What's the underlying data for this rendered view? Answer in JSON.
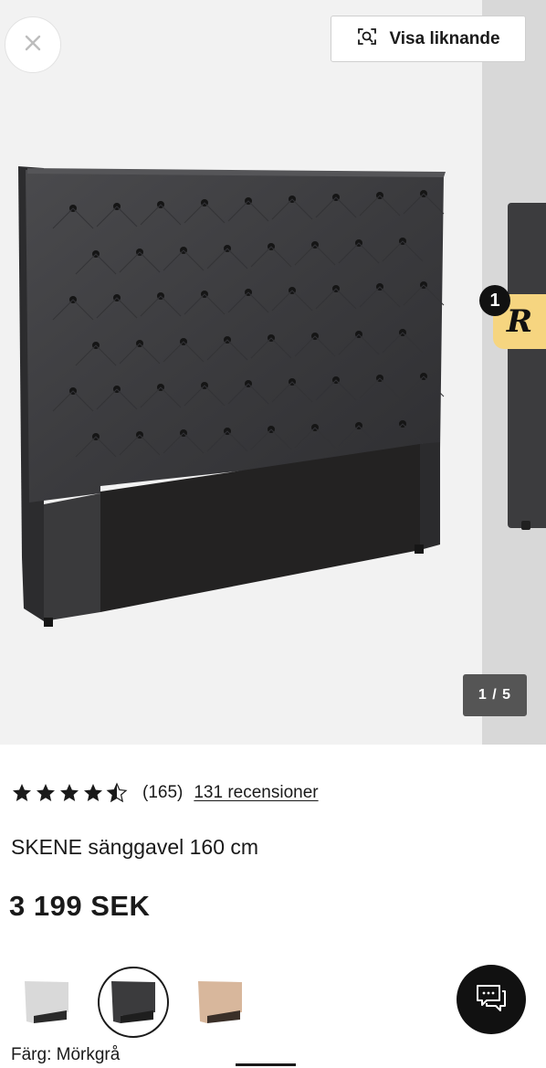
{
  "gallery": {
    "close_icon": "close-icon",
    "similar_button_label": "Visa liknande",
    "similar_icon": "visual-search-icon",
    "notification_count": "1",
    "badge_letter": "R",
    "image_counter": "1 / 5"
  },
  "product": {
    "rating": 4.5,
    "rating_count": "(165)",
    "reviews_link": "131 recensioner",
    "name": "SKENE sänggavel 160 cm",
    "price": "3 199 SEK",
    "color_label": "Färg: Mörkgrå",
    "swatches": [
      {
        "name": "light-grey",
        "color": "#d9d9d9"
      },
      {
        "name": "dark-grey",
        "color": "#3b3b3d"
      },
      {
        "name": "beige",
        "color": "#d8b79c"
      }
    ]
  },
  "chat_icon": "chat-icon",
  "colors": {
    "headboard": "#3a3a3c",
    "accent": "#f6d580",
    "text": "#1a1a1a"
  }
}
